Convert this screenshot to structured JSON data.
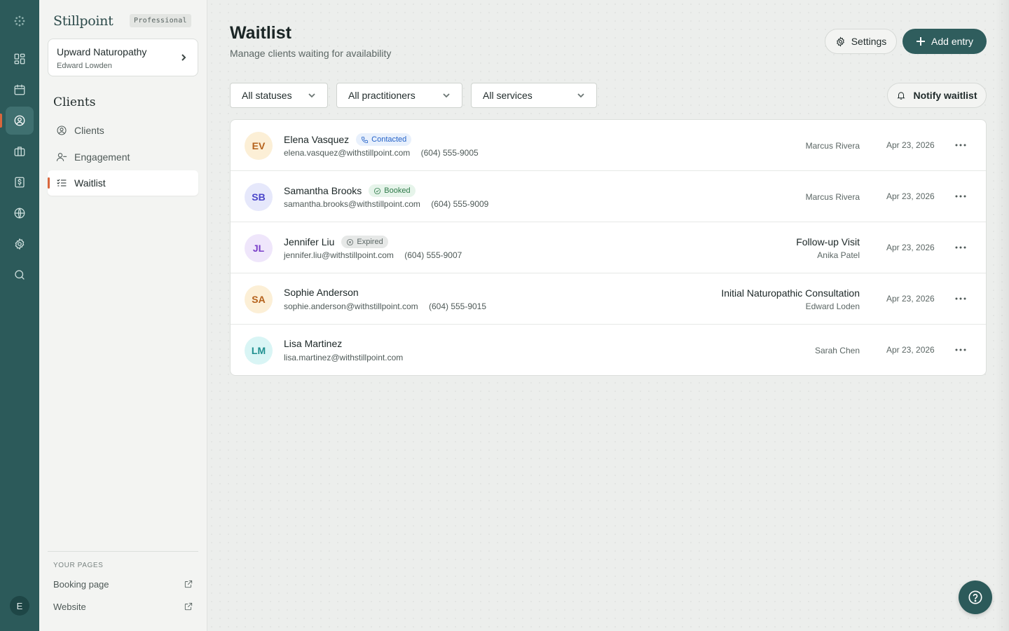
{
  "rail": {
    "icons": [
      "dots-grid-icon",
      "dashboard-icon",
      "calendar-icon",
      "clients-icon",
      "services-icon",
      "billing-icon",
      "globe-icon",
      "settings-icon",
      "search-icon"
    ],
    "active": "clients-icon",
    "user_initial": "E"
  },
  "sidebar": {
    "brand": "Stillpoint",
    "plan": "Professional",
    "org": {
      "name": "Upward Naturopathy",
      "owner": "Edward Lowden"
    },
    "section_title": "Clients",
    "items": [
      {
        "label": "Clients",
        "icon": "user-circle-icon"
      },
      {
        "label": "Engagement",
        "icon": "user-minus-icon"
      },
      {
        "label": "Waitlist",
        "icon": "checklist-icon",
        "active": true
      }
    ],
    "your_pages_label": "YOUR PAGES",
    "pages": [
      {
        "label": "Booking page",
        "icon": "external-link-icon"
      },
      {
        "label": "Website",
        "icon": "external-link-icon"
      }
    ]
  },
  "header": {
    "title": "Waitlist",
    "subtitle": "Manage clients waiting for availability",
    "settings_label": "Settings",
    "add_label": "Add entry"
  },
  "filters": {
    "statuses": "All statuses",
    "practitioners": "All practitioners",
    "services": "All services",
    "notify_label": "Notify waitlist"
  },
  "entries": [
    {
      "initials": "EV",
      "name": "Elena Vasquez",
      "status": "Contacted",
      "email": "elena.vasquez@withstillpoint.com",
      "phone": "(604) 555-9005",
      "service": "",
      "practitioner": "Marcus Rivera",
      "date": "Apr 23, 2026"
    },
    {
      "initials": "SB",
      "name": "Samantha Brooks",
      "status": "Booked",
      "email": "samantha.brooks@withstillpoint.com",
      "phone": "(604) 555-9009",
      "service": "",
      "practitioner": "Marcus Rivera",
      "date": "Apr 23, 2026"
    },
    {
      "initials": "JL",
      "name": "Jennifer Liu",
      "status": "Expired",
      "email": "jennifer.liu@withstillpoint.com",
      "phone": "(604) 555-9007",
      "service": "Follow-up Visit",
      "practitioner": "Anika Patel",
      "date": "Apr 23, 2026"
    },
    {
      "initials": "SA",
      "name": "Sophie Anderson",
      "status": "",
      "email": "sophie.anderson@withstillpoint.com",
      "phone": "(604) 555-9015",
      "service": "Initial Naturopathic Consultation",
      "practitioner": "Edward Loden",
      "date": "Apr 23, 2026"
    },
    {
      "initials": "LM",
      "name": "Lisa Martinez",
      "status": "",
      "email": "lisa.martinez@withstillpoint.com",
      "phone": "",
      "service": "",
      "practitioner": "Sarah Chen",
      "date": "Apr 23, 2026"
    }
  ],
  "colors": {
    "rail": "#2c5a5a",
    "accent": "#d9663c",
    "primary_button": "#2f5d5d",
    "contacted": "#2563c9",
    "booked": "#2f7a4a",
    "expired": "#5b6664"
  }
}
